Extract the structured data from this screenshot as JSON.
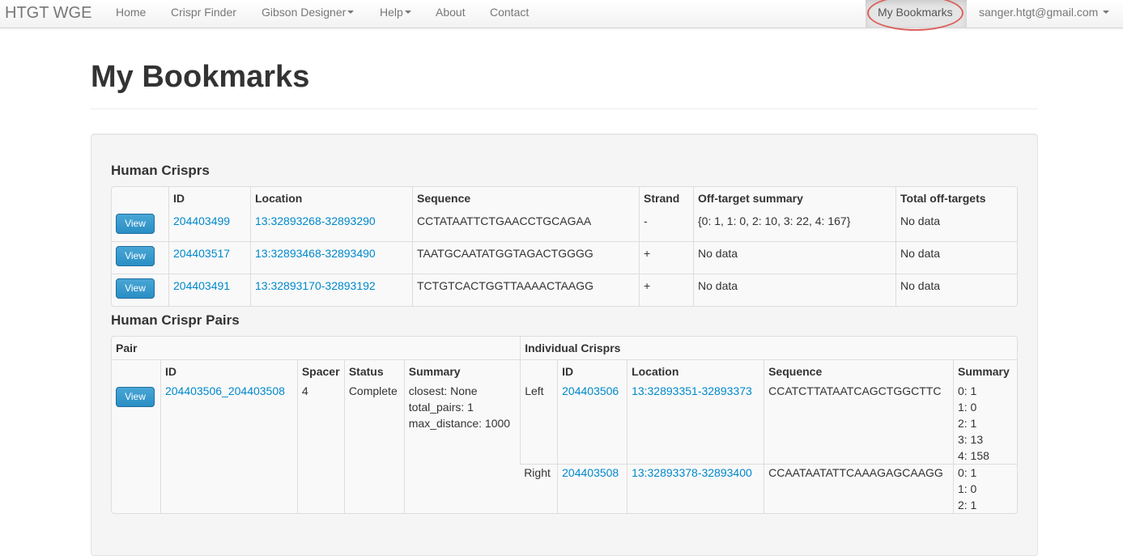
{
  "navbar": {
    "brand": "HTGT WGE",
    "items": [
      "Home",
      "Crispr Finder",
      "Gibson Designer",
      "Help",
      "About",
      "Contact"
    ],
    "bookmarks": "My Bookmarks",
    "user": "sanger.htgt@gmail.com"
  },
  "page": {
    "title": "My Bookmarks"
  },
  "crisprs": {
    "title": "Human Crisprs",
    "headers": [
      "ID",
      "Location",
      "Sequence",
      "Strand",
      "Off-target summary",
      "Total off-targets"
    ],
    "view_label": "View",
    "rows": [
      {
        "id": "204403499",
        "location": "13:32893268-32893290",
        "sequence": "CCTATAATTCTGAACCTGCAGAA",
        "strand": "-",
        "summary": "{0: 1, 1: 0, 2: 10, 3: 22, 4: 167}",
        "total": "No data"
      },
      {
        "id": "204403517",
        "location": "13:32893468-32893490",
        "sequence": "TAATGCAATATGGTAGACTGGGG",
        "strand": "+",
        "summary": "No data",
        "total": "No data"
      },
      {
        "id": "204403491",
        "location": "13:32893170-32893192",
        "sequence": "TCTGTCACTGGTTAAAACTAAGG",
        "strand": "+",
        "summary": "No data",
        "total": "No data"
      }
    ]
  },
  "pairs": {
    "title": "Human Crispr Pairs",
    "group_pair": "Pair",
    "group_individual": "Individual Crisprs",
    "headers": [
      "ID",
      "Spacer",
      "Status",
      "Summary",
      "ID",
      "Location",
      "Sequence",
      "Summary"
    ],
    "row": {
      "id": "204403506_204403508",
      "spacer": "4",
      "status": "Complete",
      "summary": [
        "closest: None",
        "total_pairs: 1",
        "max_distance: 1000"
      ],
      "left_label": "Left",
      "left_id": "204403506",
      "left_location": "13:32893351-32893373",
      "left_sequence": "CCATCTTATAATCAGCTGGCTTC",
      "left_summary": [
        "0: 1",
        "1: 0",
        "2: 1",
        "3: 13",
        "4: 158"
      ],
      "right_label": "Right",
      "right_id": "204403508",
      "right_location": "13:32893378-32893400",
      "right_sequence": "CCAATAATATTCAAAGAGCAAGG",
      "right_summary": [
        "0: 1",
        "1: 0",
        "2: 1"
      ]
    }
  }
}
